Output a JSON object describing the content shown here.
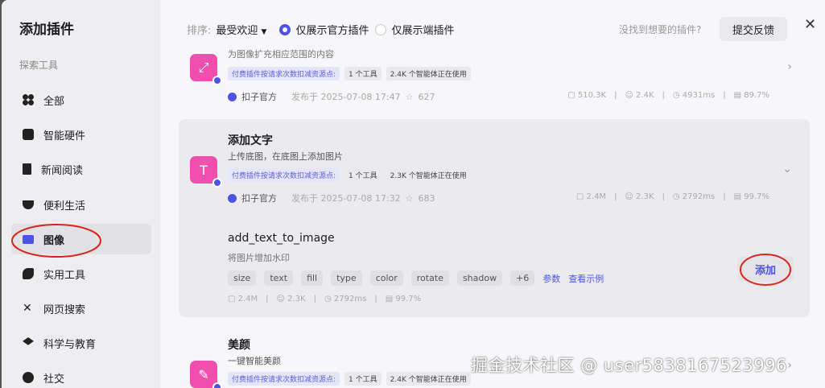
{
  "sidebar": {
    "title": "添加插件",
    "section": "探索工具",
    "items": [
      {
        "label": "全部",
        "icon": "grid-icon"
      },
      {
        "label": "智能硬件",
        "icon": "chip-icon"
      },
      {
        "label": "新闻阅读",
        "icon": "book-icon"
      },
      {
        "label": "便利生活",
        "icon": "coffee-icon"
      },
      {
        "label": "图像",
        "icon": "image-icon"
      },
      {
        "label": "实用工具",
        "icon": "wrench-icon"
      },
      {
        "label": "网页搜索",
        "icon": "network-icon"
      },
      {
        "label": "科学与教育",
        "icon": "graduation-icon"
      },
      {
        "label": "社交",
        "icon": "chat-icon"
      }
    ]
  },
  "header": {
    "sort_label": "排序:",
    "sort_value": "最受欢迎",
    "official_only": "仅展示官方插件",
    "client_only": "仅展示端插件",
    "hint": "没找到想要的插件?",
    "feedback": "提交反馈"
  },
  "plugins": [
    {
      "desc": "为图像扩充相应范围的内容",
      "paid": "付费插件按请求次数扣减资源点:",
      "tools": "1 个工具",
      "usage": "2.4K 个智能体正在使用",
      "author": "扣子官方",
      "published": "发布于 2025-07-08 17:47",
      "stars": "627",
      "stats": [
        "510.3K",
        "2.4K",
        "4931ms",
        "89.7%"
      ]
    },
    {
      "title": "添加文字",
      "desc": "上传底图，在底图上添加图片",
      "paid": "付费插件按请求次数扣减资源点:",
      "tools": "1 个工具",
      "usage": "2.3K 个智能体正在使用",
      "author": "扣子官方",
      "published": "发布于 2025-07-08 17:32",
      "stars": "683",
      "stats": [
        "2.4M",
        "2.3K",
        "2792ms",
        "99.7%"
      ],
      "tool": {
        "name": "add_text_to_image",
        "desc": "将图片增加水印",
        "params": [
          "size",
          "text",
          "fill",
          "type",
          "color",
          "rotate",
          "shadow",
          "+6"
        ],
        "params_link": "参数",
        "example_link": "查看示例",
        "add": "添加",
        "stats": [
          "2.4M",
          "2.3K",
          "2792ms",
          "99.7%"
        ]
      }
    },
    {
      "title": "美颜",
      "desc": "一键智能美颜",
      "paid": "付费插件按请求次数扣减资源点:",
      "tools": "1 个工具",
      "usage": "2.4K 个智能体正在使用"
    }
  ],
  "watermark": "掘金技术社区 @ user5838167523996"
}
